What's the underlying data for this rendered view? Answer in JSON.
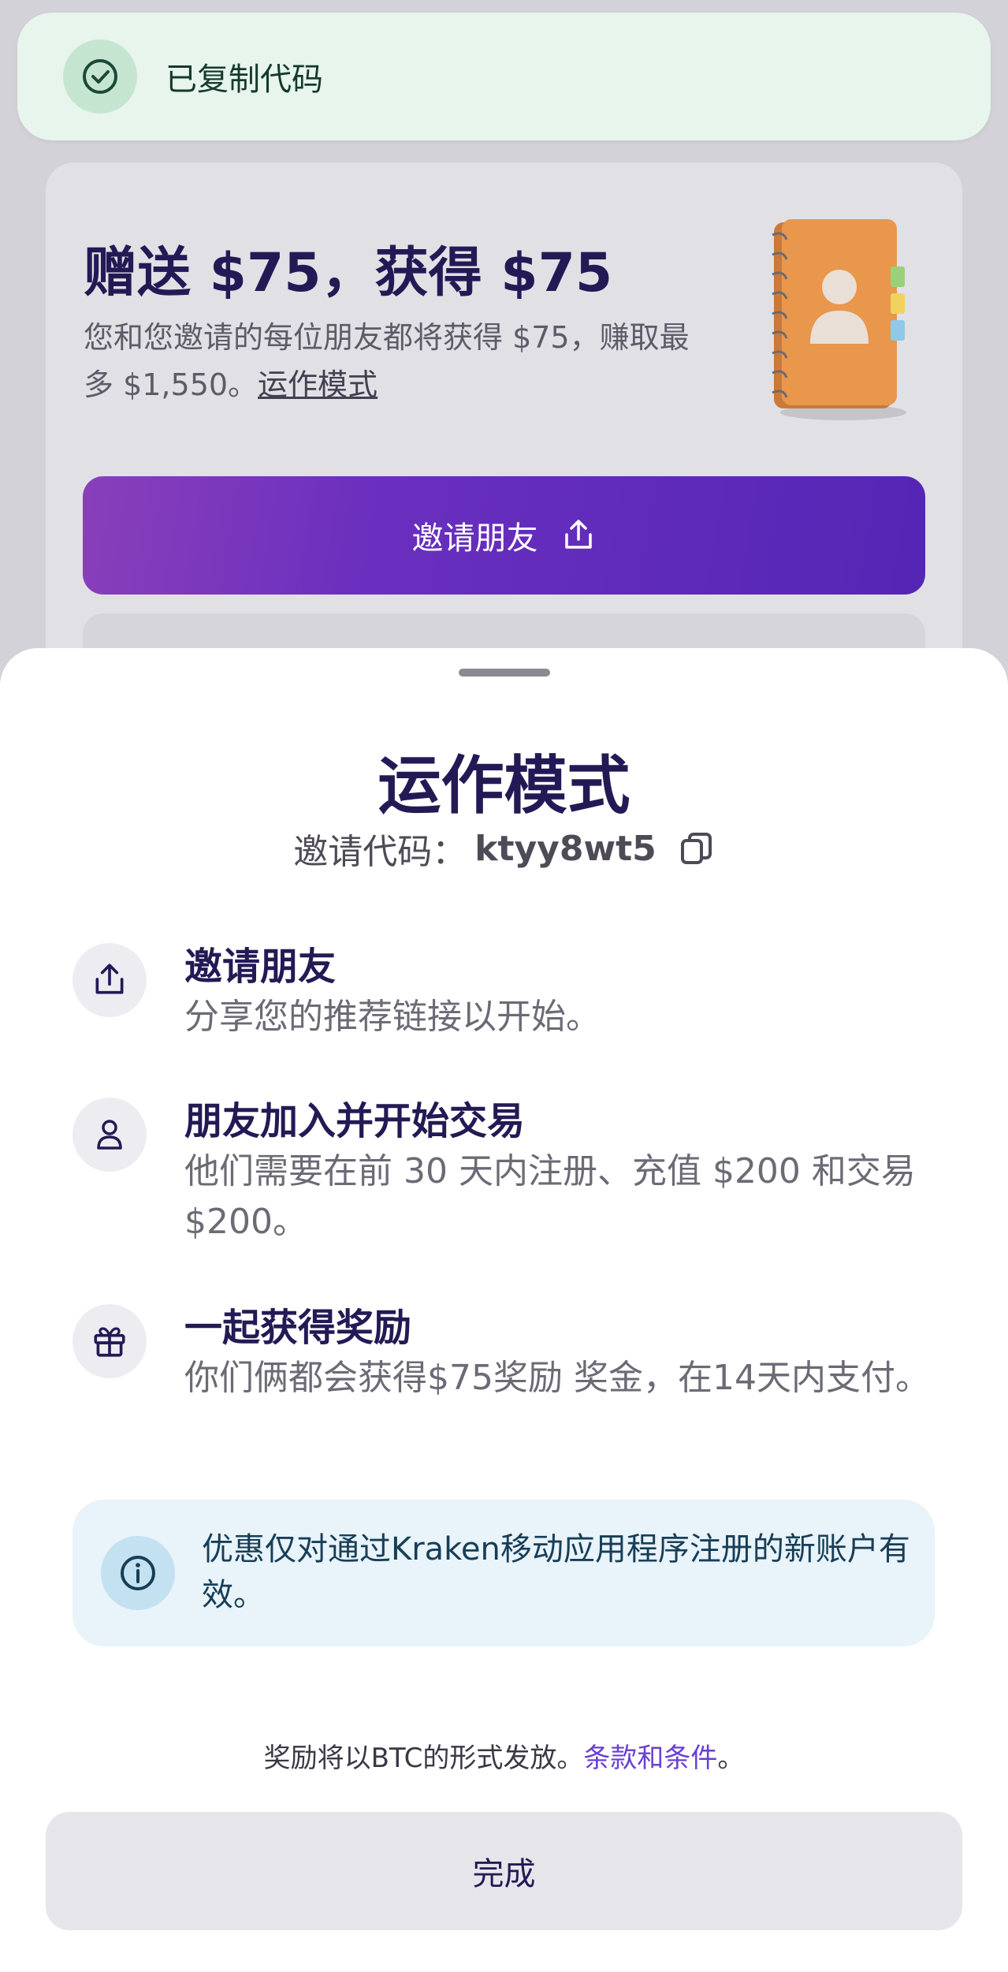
{
  "toast": {
    "text": "已复制代码",
    "icon": "check-circle-icon"
  },
  "promo": {
    "title": "赠送 $75，获得 $75",
    "description": "您和您邀请的每位朋友都将获得 $75，赚取最多 $1,550。",
    "link": "运作模式",
    "image": "address-book-notebook",
    "invite_button": "邀请朋友",
    "invite_icon": "share-icon"
  },
  "sheet": {
    "title": "运作模式",
    "code_label": "邀请代码：",
    "code_value": "ktyy8wt5",
    "copy_icon": "copy-icon",
    "steps": [
      {
        "icon": "share-icon",
        "title": "邀请朋友",
        "description": "分享您的推荐链接以开始。"
      },
      {
        "icon": "user-icon",
        "title": "朋友加入并开始交易",
        "description": "他们需要在前 30 天内注册、充值 $200 和交易 $200。"
      },
      {
        "icon": "gift-icon",
        "title": "一起获得奖励",
        "description": "你们俩都会获得$75奖励 奖金，在14天内支付。"
      }
    ],
    "notice": {
      "icon": "info-icon",
      "text": "优惠仅对通过Kraken移动应用程序注册的新账户有效。"
    },
    "footer": {
      "text": "奖励将以BTC的形式发放。",
      "terms_link": "条款和条件",
      "period": "。"
    },
    "done_button": "完成"
  },
  "colors": {
    "brand_purple": "#5426b5",
    "title_navy": "#231a55",
    "toast_green": "#e7f5ec",
    "notice_blue": "#e8f3fa"
  }
}
